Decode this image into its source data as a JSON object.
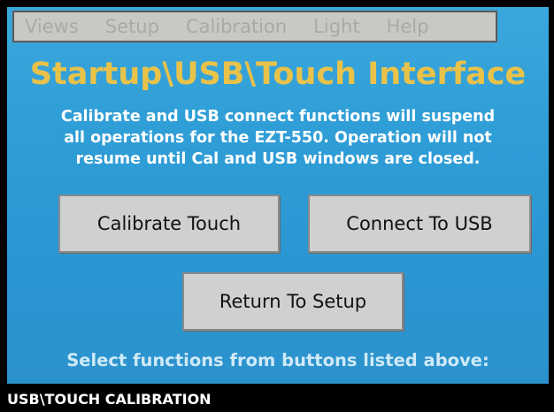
{
  "menu": {
    "items": [
      "Views",
      "Setup",
      "Calibration",
      "Light",
      "Help"
    ]
  },
  "title": "Startup\\USB\\Touch Interface",
  "description": {
    "lines": [
      "Calibrate and USB connect functions will suspend",
      "all operations for the EZT-550. Operation will not",
      "resume until Cal and USB windows are closed."
    ]
  },
  "buttons": {
    "calibrate_touch": "Calibrate Touch",
    "connect_usb": "Connect To USB",
    "return_setup": "Return To Setup"
  },
  "hint": "Select functions from buttons listed above:",
  "status": "USB\\TOUCH CALIBRATION",
  "colors": {
    "panel_background": "#2f9dd6",
    "title": "#e9c24a",
    "menu_background": "#c9c9c4",
    "menu_text": "#a8aaa8",
    "button_background": "#cfd0d0"
  }
}
